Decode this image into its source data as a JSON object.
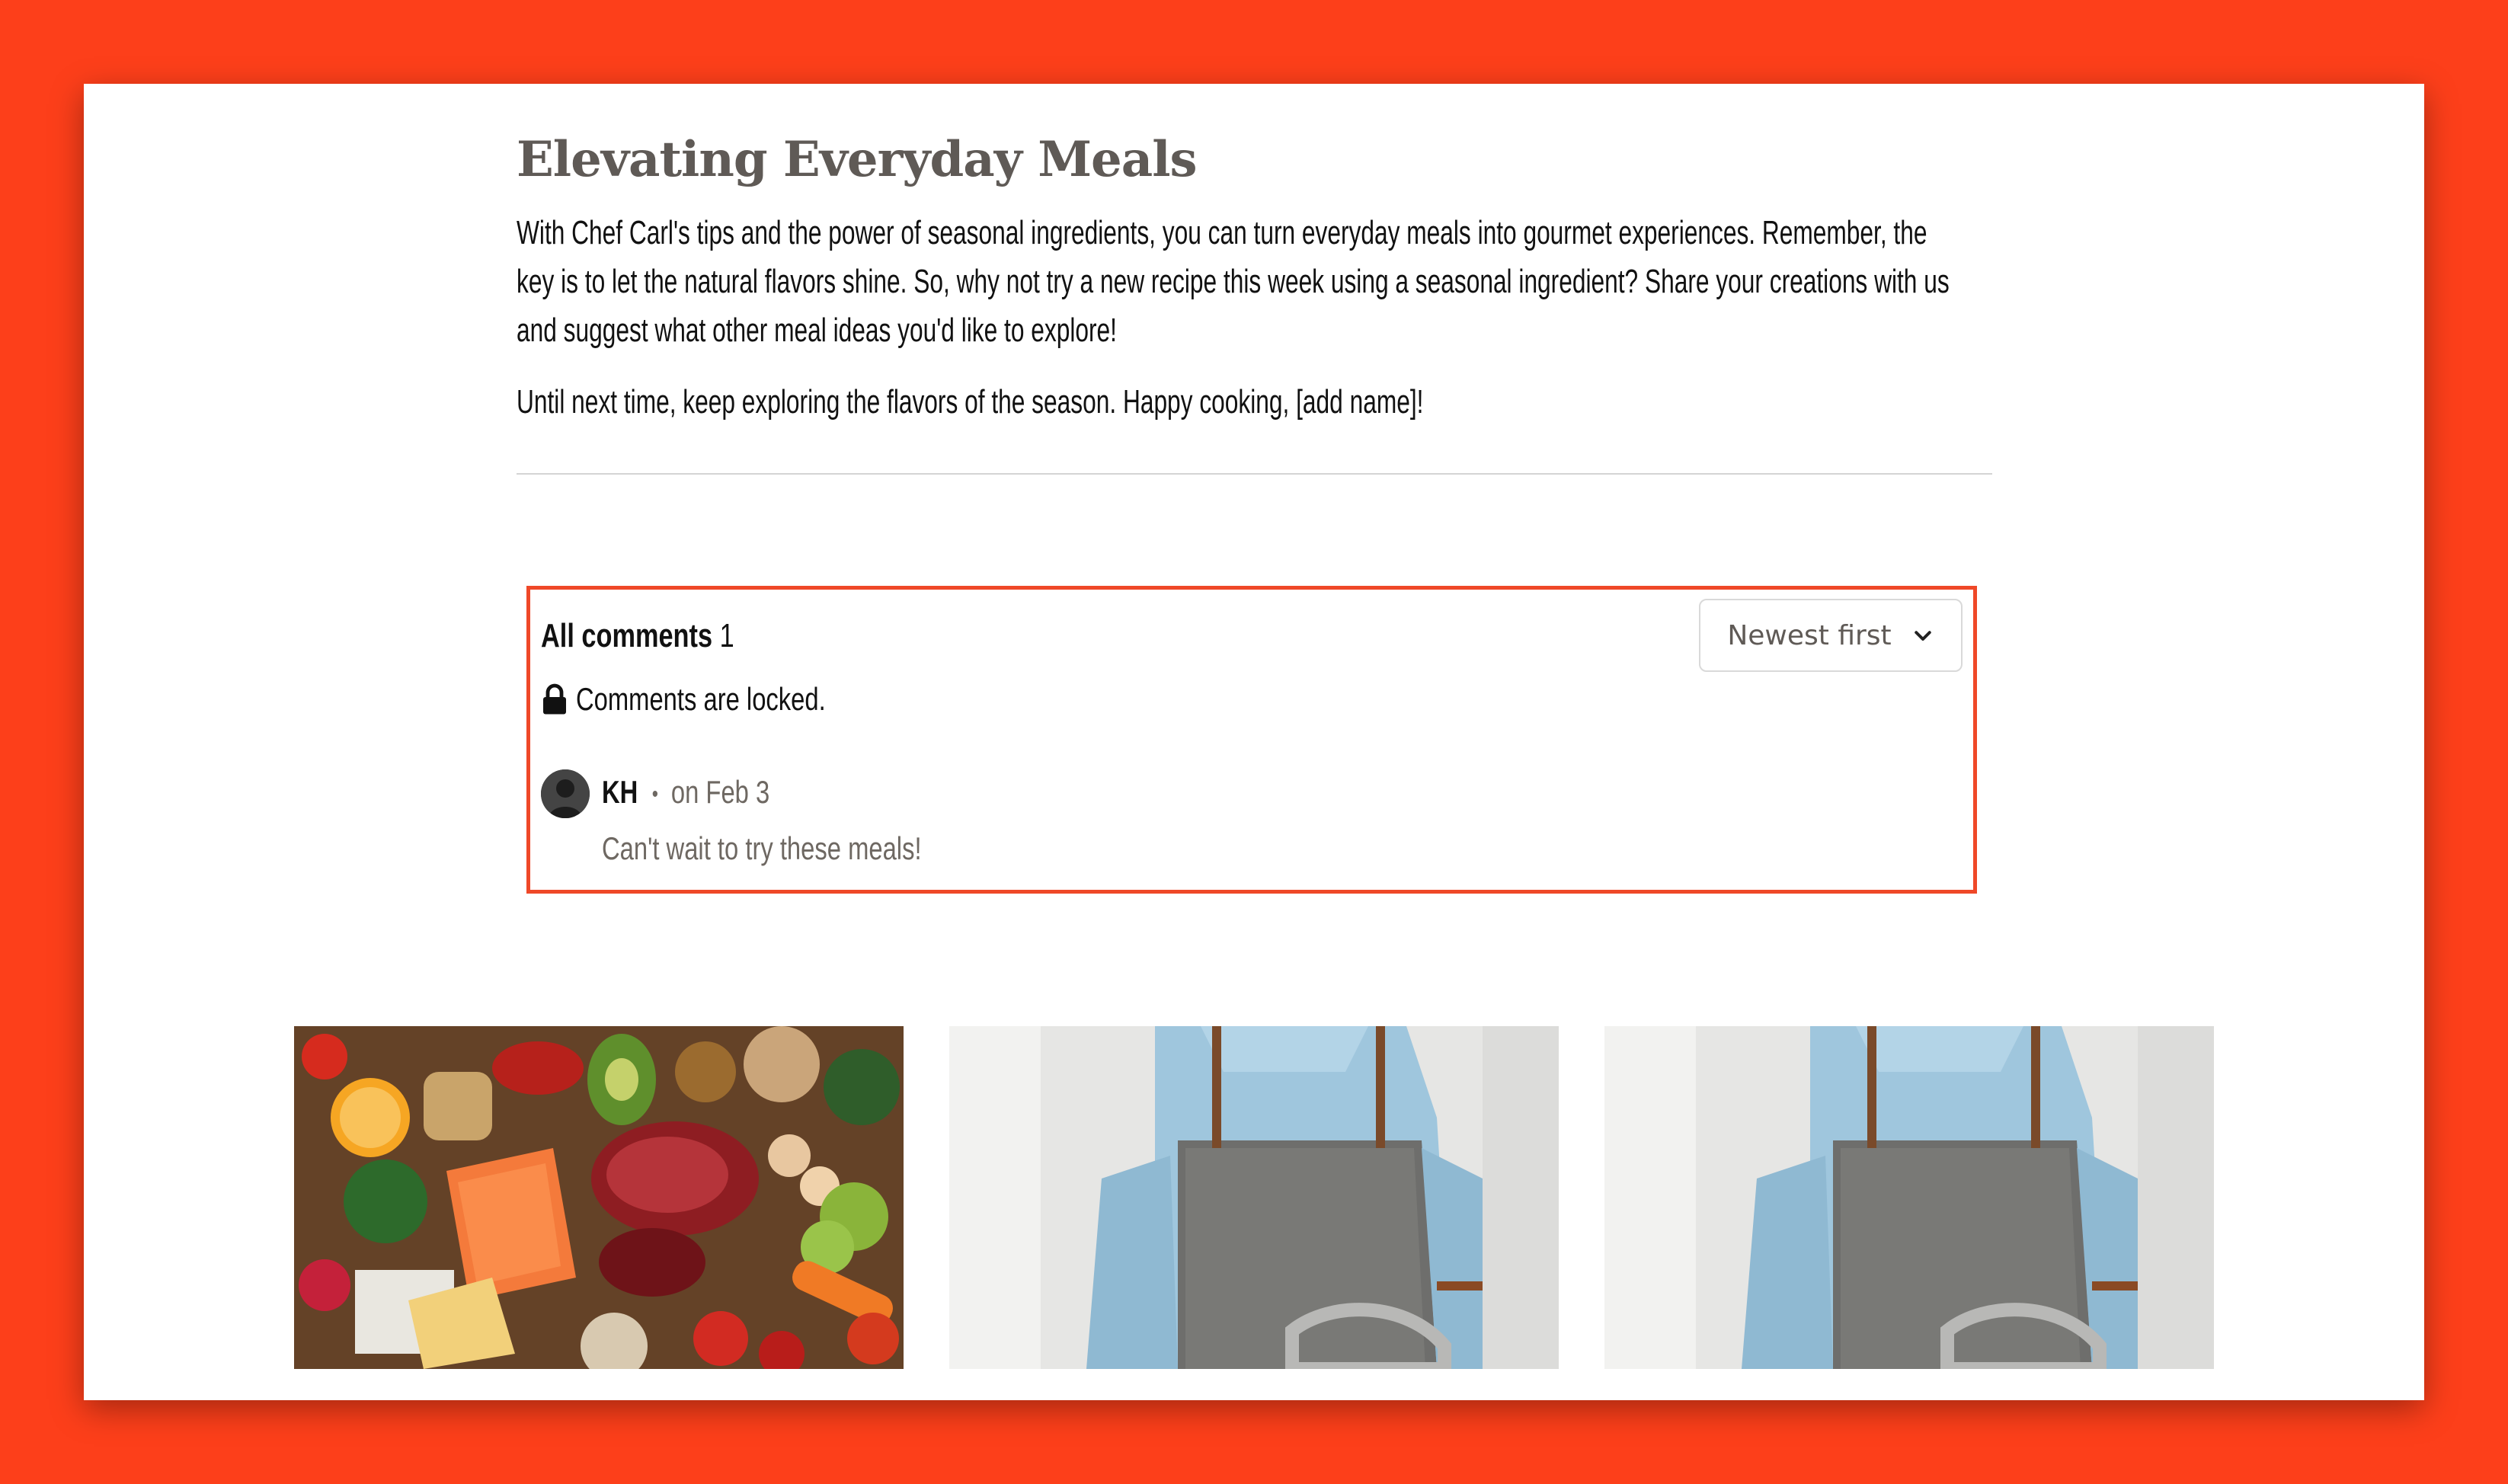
{
  "article": {
    "heading": "Elevating Everyday Meals",
    "paragraph_1": "With Chef Carl's tips and the power of seasonal ingredients, you can turn everyday meals into gourmet experiences. Remember, the key is to let the natural flavors shine. So, why not try a new recipe this week using a seasonal ingredient? Share your creations with us and suggest what other meal ideas you'd like to explore!",
    "paragraph_2": "Until next time, keep exploring the flavors of the season. Happy cooking, [add name]!"
  },
  "comments": {
    "title": "All comments",
    "count": "1",
    "sort_label": "Newest first",
    "locked_text": "Comments are locked.",
    "items": [
      {
        "author": "KH",
        "date": "on Feb 3",
        "body": "Can't wait to try these meals!"
      }
    ]
  },
  "related_posts": [
    {
      "image": "ingredients-flatlay"
    },
    {
      "image": "chef-apron"
    },
    {
      "image": "chef-apron"
    }
  ],
  "colors": {
    "background": "#fd3f1a",
    "highlight_border": "#ef4828",
    "muted_text": "#6e6862",
    "heading": "#5f5a56"
  }
}
